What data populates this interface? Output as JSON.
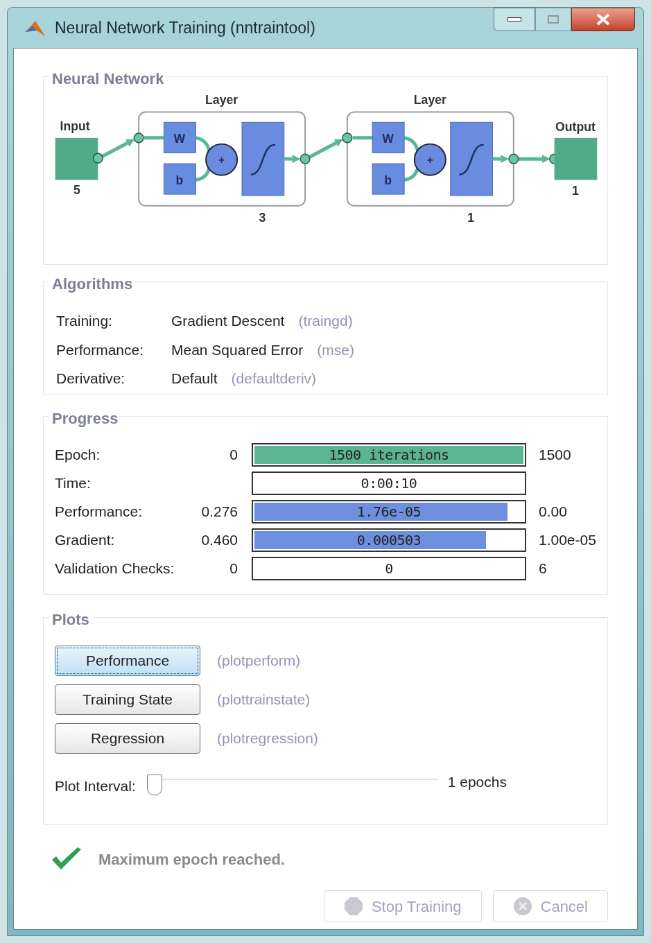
{
  "window": {
    "title": "Neural Network Training (nntraintool)"
  },
  "network": {
    "title": "Neural Network",
    "input": {
      "label": "Input",
      "size": "5"
    },
    "output": {
      "label": "Output",
      "size": "1"
    },
    "layers": [
      {
        "label": "Layer",
        "weight": "W",
        "bias": "b",
        "sum": "+",
        "size": "3"
      },
      {
        "label": "Layer",
        "weight": "W",
        "bias": "b",
        "sum": "+",
        "size": "1"
      }
    ]
  },
  "algorithms": {
    "title": "Algorithms",
    "rows": [
      {
        "label": "Training:",
        "value": "Gradient Descent",
        "code": "(traingd)"
      },
      {
        "label": "Performance:",
        "value": "Mean Squared Error",
        "code": "(mse)"
      },
      {
        "label": "Derivative:",
        "value": "Default",
        "code": "(defaultderiv)"
      }
    ]
  },
  "progress": {
    "title": "Progress",
    "rows": [
      {
        "label": "Epoch:",
        "start": "0",
        "value": "1500 iterations",
        "end": "1500",
        "level": 1,
        "color": "#5bb592"
      },
      {
        "label": "Time:",
        "value": "0:00:10"
      },
      {
        "label": "Performance:",
        "start": "0.276",
        "value": "1.76e-05",
        "end": "0.00",
        "level": 0.94,
        "color": "#6e8fde"
      },
      {
        "label": "Gradient:",
        "start": "0.460",
        "value": "0.000503",
        "end": "1.00e-05",
        "level": 0.86,
        "color": "#6e8fde"
      },
      {
        "label": "Validation Checks:",
        "start": "0",
        "value": "0",
        "end": "6"
      }
    ]
  },
  "plots": {
    "title": "Plots",
    "buttons": [
      {
        "label": "Performance",
        "code": "(plotperform)",
        "selected": true
      },
      {
        "label": "Training State",
        "code": "(plottrainstate)",
        "selected": false
      },
      {
        "label": "Regression",
        "code": "(plotregression)",
        "selected": false
      }
    ],
    "interval": {
      "label": "Plot Interval:",
      "level": 0,
      "reading": "1 epochs"
    }
  },
  "status": {
    "message": "Maximum epoch reached."
  },
  "buttons": [
    {
      "label": "Stop Training",
      "kind": "stop",
      "disabled": true
    },
    {
      "label": "Cancel",
      "kind": "cancel",
      "disabled": true
    }
  ]
}
